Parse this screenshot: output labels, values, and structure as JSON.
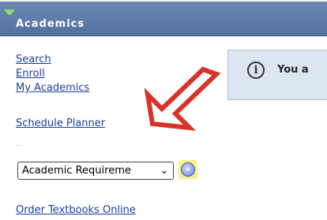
{
  "header": {
    "title": "Academics"
  },
  "links": {
    "search": "Search",
    "enroll": "Enroll",
    "my_academics": "My Academics",
    "schedule_planner": "Schedule Planner",
    "order_textbooks": "Order Textbooks Online"
  },
  "message": {
    "text": "You a"
  },
  "dropdown": {
    "selected": "Academic Requireme"
  },
  "icons": {
    "expand": "triangle-down-icon",
    "info": "info-icon",
    "go": "double-chevron-right-icon",
    "annotation": "red-arrow-icon",
    "dropdown": "chevron-down-icon"
  },
  "colors": {
    "header": "#5f7ca8",
    "link": "#1d3d9e",
    "arrow": "#d8332a",
    "message_bg": "#dbe6f1"
  }
}
